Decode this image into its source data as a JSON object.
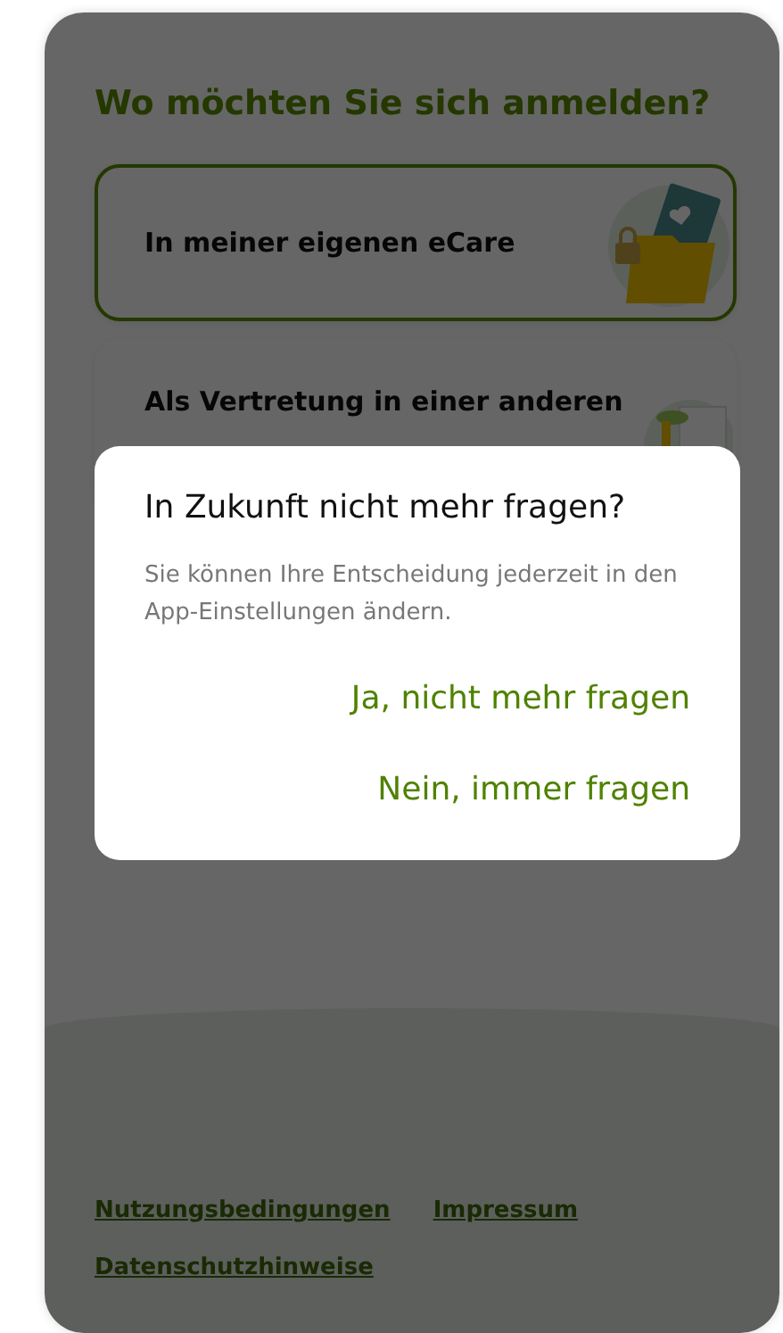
{
  "title": "Wo möchten Sie sich anmelden?",
  "options": [
    {
      "label": "In meiner eigenen eCare",
      "selected": true,
      "kind": "folder"
    },
    {
      "label": "Als Vertretung in einer anderen",
      "selected": false,
      "kind": "coins"
    }
  ],
  "footer_links": [
    "Nutzungsbedingungen",
    "Impressum",
    "Datenschutzhinweise"
  ],
  "dialog": {
    "title": "In Zukunft nicht mehr fragen?",
    "message": "Sie können Ihre Entscheidung jederzeit in den App-Einstellungen ändern.",
    "buttons": [
      "Ja, nicht mehr fragen",
      "Nein, immer fragen"
    ]
  }
}
